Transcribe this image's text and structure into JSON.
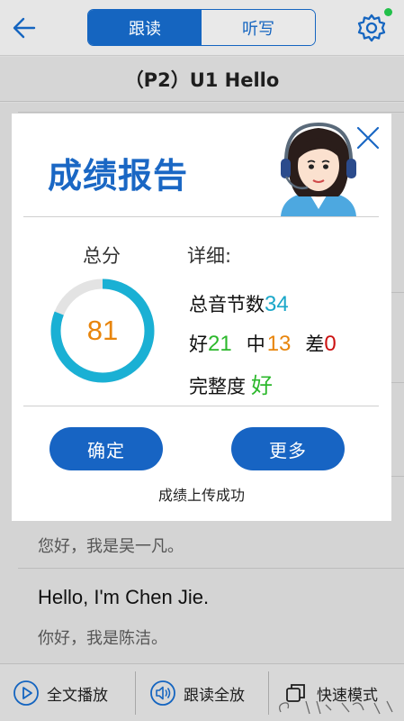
{
  "header": {
    "tabs": [
      {
        "label": "跟读",
        "active": true
      },
      {
        "label": "听写",
        "active": false
      }
    ],
    "accent_color": "#1565c0"
  },
  "lesson": {
    "title": "（P2）U1 Hello"
  },
  "sentences": [
    {
      "cn": "您好，我是吴一凡。"
    },
    {
      "en": "Hello, I'm Chen Jie.",
      "cn": "你好，我是陈洁。"
    }
  ],
  "bottom_bar": {
    "play_all": "全文播放",
    "follow_all": "跟读全放",
    "quick_mode": "快速模式"
  },
  "report": {
    "title": "成绩报告",
    "total_score_label": "总分",
    "total_score": "81",
    "score_fraction": 0.81,
    "detail_label": "详细:",
    "syllables_label": "总音节数",
    "syllables": "34",
    "good_label": "好",
    "good": "21",
    "mid_label": "中",
    "mid": "13",
    "bad_label": "差",
    "bad": "0",
    "completeness_label": "完整度",
    "completeness": "好",
    "confirm_button": "确定",
    "more_button": "更多",
    "upload_status": "成绩上传成功",
    "colors": {
      "ring": "#1ab0d4",
      "ring_track": "#e3e3e3",
      "score": "#e8850c",
      "syllables": "#1aa7c9",
      "good": "#2cb82c",
      "mid": "#e8850c",
      "bad": "#cc1111",
      "completeness": "#2cb82c"
    }
  }
}
